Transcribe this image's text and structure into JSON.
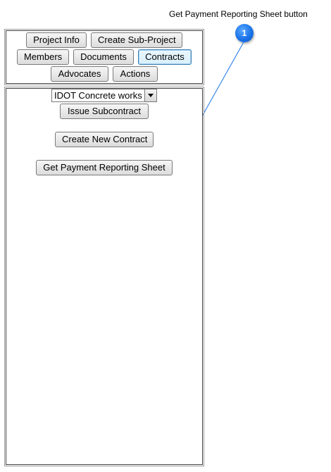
{
  "annotation": {
    "title": "Get Payment Reporting Sheet button",
    "badge_number": "1",
    "badge_color": "#1a73e8"
  },
  "nav": {
    "project_info": "Project Info",
    "create_sub_project": "Create Sub-Project",
    "members": "Members",
    "documents": "Documents",
    "contracts": "Contracts",
    "advocates": "Advocates",
    "actions": "Actions",
    "active_tab": "Contracts"
  },
  "contracts": {
    "selected_contract": "IDOT Concrete works",
    "issue_subcontract": "Issue Subcontract",
    "create_new_contract": "Create New Contract",
    "get_payment_reporting_sheet": "Get Payment Reporting Sheet"
  }
}
